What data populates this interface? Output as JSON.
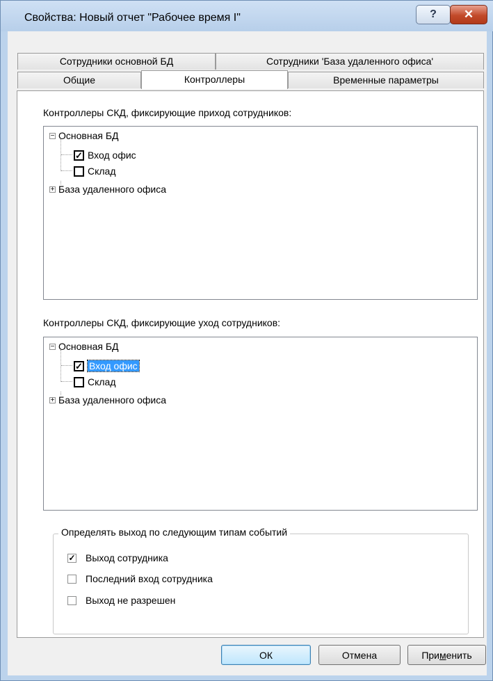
{
  "window": {
    "title": "Свойства: Новый отчет \"Рабочее время I\"",
    "help_label": "?",
    "close_label": "✕"
  },
  "tabs": {
    "row1": [
      "Сотрудники основной БД",
      "Сотрудники 'База удаленного офиса'"
    ],
    "row2": [
      "Общие",
      "Контроллеры",
      "Временные параметры"
    ],
    "active": "Контроллеры"
  },
  "entry_section": {
    "label": "Контроллеры СКД, фиксирующие приход сотрудников:",
    "tree": [
      {
        "label": "Основная БД",
        "expander": "−"
      },
      {
        "label": "Вход офис",
        "checked": true,
        "mark": "✓"
      },
      {
        "label": "Склад",
        "checked": false,
        "mark": ""
      },
      {
        "label": "База удаленного офиса",
        "expander": "+"
      }
    ]
  },
  "exit_section": {
    "label": "Контроллеры СКД, фиксирующие уход сотрудников:",
    "tree": [
      {
        "label": "Основная БД",
        "expander": "−"
      },
      {
        "label": "Вход офис",
        "checked": true,
        "mark": "✓",
        "selected": true
      },
      {
        "label": "Склад",
        "checked": false,
        "mark": ""
      },
      {
        "label": "База удаленного офиса",
        "expander": "+"
      }
    ]
  },
  "event_group": {
    "title": "Определять выход по следующим типам событий",
    "options": [
      {
        "label": "Выход сотрудника",
        "checked": true,
        "mark": "✓"
      },
      {
        "label": "Последний вход сотрудника",
        "checked": false,
        "mark": ""
      },
      {
        "label": "Выход не разрешен",
        "checked": false,
        "mark": ""
      }
    ]
  },
  "buttons": {
    "ok": "ОК",
    "cancel": "Отмена",
    "apply_pre": "При",
    "apply_mnemonic": "м",
    "apply_post": "енить"
  },
  "colors": {
    "title_bar": "#b7cfea",
    "selection": "#3399ff",
    "close_button": "#c24a2a"
  },
  "icons": [
    "help-icon",
    "close-icon",
    "collapse-icon",
    "expand-icon",
    "check-icon"
  ]
}
